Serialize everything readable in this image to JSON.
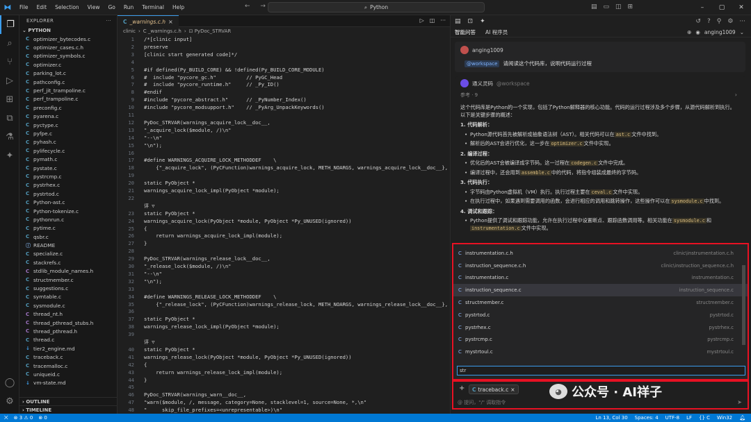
{
  "titlebar": {
    "menu": [
      "File",
      "Edit",
      "Selection",
      "View",
      "Go",
      "Run",
      "Terminal",
      "Help"
    ],
    "search": "Python",
    "nav": "← →"
  },
  "sidebar": {
    "header": "EXPLORER",
    "folder": "PYTHON",
    "files": [
      {
        "n": "optimizer_bytecodes.c",
        "t": "c"
      },
      {
        "n": "optimizer_cases.c.h",
        "t": "c"
      },
      {
        "n": "optimizer_symbols.c",
        "t": "c"
      },
      {
        "n": "optimizer.c",
        "t": "c"
      },
      {
        "n": "parking_lot.c",
        "t": "c"
      },
      {
        "n": "pathconfig.c",
        "t": "c"
      },
      {
        "n": "perf_jit_trampoline.c",
        "t": "c"
      },
      {
        "n": "perf_trampoline.c",
        "t": "c"
      },
      {
        "n": "preconfig.c",
        "t": "c"
      },
      {
        "n": "pyarena.c",
        "t": "c"
      },
      {
        "n": "pyctype.c",
        "t": "c"
      },
      {
        "n": "pyfpe.c",
        "t": "c"
      },
      {
        "n": "pyhash.c",
        "t": "c"
      },
      {
        "n": "pylifecycle.c",
        "t": "c"
      },
      {
        "n": "pymath.c",
        "t": "c"
      },
      {
        "n": "pystate.c",
        "t": "c"
      },
      {
        "n": "pystrcmp.c",
        "t": "c"
      },
      {
        "n": "pystrhex.c",
        "t": "c"
      },
      {
        "n": "pystrtod.c",
        "t": "c"
      },
      {
        "n": "Python-ast.c",
        "t": "c"
      },
      {
        "n": "Python-tokenize.c",
        "t": "c"
      },
      {
        "n": "pythonrun.c",
        "t": "c"
      },
      {
        "n": "pytime.c",
        "t": "c"
      },
      {
        "n": "qsbr.c",
        "t": "c"
      },
      {
        "n": "README",
        "t": "i"
      },
      {
        "n": "specialize.c",
        "t": "c"
      },
      {
        "n": "stackrefs.c",
        "t": "c"
      },
      {
        "n": "stdlib_module_names.h",
        "t": "h"
      },
      {
        "n": "structmember.c",
        "t": "c"
      },
      {
        "n": "suggestions.c",
        "t": "c"
      },
      {
        "n": "symtable.c",
        "t": "c"
      },
      {
        "n": "sysmodule.c",
        "t": "c"
      },
      {
        "n": "thread_nt.h",
        "t": "h"
      },
      {
        "n": "thread_pthread_stubs.h",
        "t": "h"
      },
      {
        "n": "thread_pthread.h",
        "t": "h"
      },
      {
        "n": "thread.c",
        "t": "c"
      },
      {
        "n": "tier2_engine.md",
        "t": "md"
      },
      {
        "n": "traceback.c",
        "t": "c"
      },
      {
        "n": "tracemalloc.c",
        "t": "c"
      },
      {
        "n": "uniqueid.c",
        "t": "c"
      },
      {
        "n": "vm-state.md",
        "t": "md"
      }
    ],
    "outline": "OUTLINE",
    "timeline": "TIMELINE"
  },
  "editor": {
    "tab": "_warnings.c.h",
    "tab_prefix": "C",
    "crumb": [
      "clinic",
      "C _warnings.c.h",
      "⊡ PyDoc_STRVAR"
    ],
    "lines": [
      {
        "n": "1",
        "c": "cm",
        "t": "/*[clinic input]"
      },
      {
        "n": "2",
        "c": "cm",
        "t": "preserve"
      },
      {
        "n": "3",
        "c": "cm",
        "t": "[clinic start generated code]*/"
      },
      {
        "n": "4",
        "c": "",
        "t": ""
      },
      {
        "n": "5",
        "c": "pp",
        "t": "#if defined(Py_BUILD_CORE) && !defined(Py_BUILD_CORE_MODULE)"
      },
      {
        "n": "6",
        "c": "cm",
        "t": "#  include \"pycore_gc.h\"          // PyGC_Head"
      },
      {
        "n": "7",
        "c": "cm",
        "t": "#  include \"pycore_runtime.h\"     // _Py_ID()"
      },
      {
        "n": "8",
        "c": "pp",
        "t": "#endif"
      },
      {
        "n": "9",
        "c": "pp",
        "t": "#include \"pycore_abstract.h\"      // _PyNumber_Index()"
      },
      {
        "n": "10",
        "c": "pp",
        "t": "#include \"pycore_modsupport.h\"    // _PyArg_UnpackKeywords()"
      },
      {
        "n": "11",
        "c": "",
        "t": ""
      },
      {
        "n": "12",
        "c": "",
        "t": "PyDoc_STRVAR(warnings_acquire_lock__doc__,"
      },
      {
        "n": "13",
        "c": "st",
        "t": "\"_acquire_lock($module, /)\\n\""
      },
      {
        "n": "14",
        "c": "st",
        "t": "\"--\\n\""
      },
      {
        "n": "15",
        "c": "st",
        "t": "\"\\n\");"
      },
      {
        "n": "16",
        "c": "",
        "t": ""
      },
      {
        "n": "17",
        "c": "mac",
        "t": "#define WARNINGS_ACQUIRE_LOCK_METHODDEF    \\"
      },
      {
        "n": "18",
        "c": "st",
        "t": "    {\"_acquire_lock\", (PyCFunction)warnings_acquire_lock, METH_NOARGS, warnings_acquire_lock__doc__},"
      },
      {
        "n": "19",
        "c": "",
        "t": ""
      },
      {
        "n": "20",
        "c": "kw",
        "t": "static PyObject *"
      },
      {
        "n": "21",
        "c": "",
        "t": "warnings_acquire_lock_impl(PyObject *module);"
      },
      {
        "n": "22",
        "c": "",
        "t": ""
      },
      {
        "n": "",
        "c": "codelens",
        "t": "评 ▽"
      },
      {
        "n": "23",
        "c": "kw",
        "t": "static PyObject *"
      },
      {
        "n": "24",
        "c": "",
        "t": "warnings_acquire_lock(PyObject *module, PyObject *Py_UNUSED(ignored))"
      },
      {
        "n": "25",
        "c": "",
        "t": "{"
      },
      {
        "n": "26",
        "c": "",
        "t": "    return warnings_acquire_lock_impl(module);"
      },
      {
        "n": "27",
        "c": "",
        "t": "}"
      },
      {
        "n": "28",
        "c": "",
        "t": ""
      },
      {
        "n": "29",
        "c": "",
        "t": "PyDoc_STRVAR(warnings_release_lock__doc__,"
      },
      {
        "n": "30",
        "c": "st",
        "t": "\"_release_lock($module, /)\\n\""
      },
      {
        "n": "31",
        "c": "st",
        "t": "\"--\\n\""
      },
      {
        "n": "32",
        "c": "st",
        "t": "\"\\n\");"
      },
      {
        "n": "33",
        "c": "",
        "t": ""
      },
      {
        "n": "34",
        "c": "mac",
        "t": "#define WARNINGS_RELEASE_LOCK_METHODDEF    \\"
      },
      {
        "n": "35",
        "c": "st",
        "t": "    {\"_release_lock\", (PyCFunction)warnings_release_lock, METH_NOARGS, warnings_release_lock__doc__},"
      },
      {
        "n": "36",
        "c": "",
        "t": ""
      },
      {
        "n": "37",
        "c": "kw",
        "t": "static PyObject *"
      },
      {
        "n": "38",
        "c": "",
        "t": "warnings_release_lock_impl(PyObject *module);"
      },
      {
        "n": "39",
        "c": "",
        "t": ""
      },
      {
        "n": "",
        "c": "codelens",
        "t": "评 ▽"
      },
      {
        "n": "40",
        "c": "kw",
        "t": "static PyObject *"
      },
      {
        "n": "41",
        "c": "",
        "t": "warnings_release_lock(PyObject *module, PyObject *Py_UNUSED(ignored))"
      },
      {
        "n": "42",
        "c": "",
        "t": "{"
      },
      {
        "n": "43",
        "c": "",
        "t": "    return warnings_release_lock_impl(module);"
      },
      {
        "n": "44",
        "c": "",
        "t": "}"
      },
      {
        "n": "45",
        "c": "",
        "t": ""
      },
      {
        "n": "46",
        "c": "",
        "t": "PyDoc_STRVAR(warnings_warn__doc__,"
      },
      {
        "n": "47",
        "c": "st",
        "t": "\"warn($module, /, message, category=None, stacklevel=1, source=None, *,\\n\""
      },
      {
        "n": "48",
        "c": "st",
        "t": "\"     skip_file_prefixes=<unrepresentable>)\\n\""
      },
      {
        "n": "49",
        "c": "st",
        "t": "\"--\\n\""
      }
    ]
  },
  "panel": {
    "tabs": [
      "智能问答",
      "AI 程序员"
    ],
    "user": "anging1009",
    "question": {
      "user": "anging1009",
      "tag": "@workspace",
      "text": "请阅读这个代码库，说明代码运行过程"
    },
    "answer": {
      "bot": "通义灵码",
      "tag": "@workspace",
      "ref": "参考 · 9",
      "intro": "这个代码库是Python的一个实现，包括了Python解释器的核心功能。代码的运行过程涉及多个步骤，从源代码解析到执行。以下是关键步骤的概述：",
      "s1": "1. 代码解析：",
      "s1a": "Python源代码首先被解析成抽象语法树（AST）。相关代码可以在",
      "s1a_c": "ast.c",
      "s1a_e": "文件中找到。",
      "s1b": "解析后的AST会进行优化，这一步在",
      "s1b_c": "optimizer.c",
      "s1b_e": "文件中实现。",
      "s2": "2. 编译过程：",
      "s2a": "优化后的AST会被编译成字节码。这一过程在",
      "s2a_c": "codegen.c",
      "s2a_e": "文件中完成。",
      "s2b": "编译过程中，还会用到",
      "s2b_c": "assemble.c",
      "s2b_e": "中的代码，将指令组装成最终的字节码。",
      "s3": "3. 代码执行：",
      "s3a": "字节码由Python虚拟机（VM）执行。执行过程主要在",
      "s3a_c": "ceval.c",
      "s3a_e": "文件中实现。",
      "s3b": "在执行过程中，如果遇到需要调用的函数，会进行相应的调用和跳转操作，这些操作可以在",
      "s3b_c": "sysmodule.c",
      "s3b_e": "中找到。",
      "s4": "4. 调试和跟踪：",
      "s4a": "Python提供了调试和跟踪功能，允许在执行过程中设置断点、跟踪函数调用等。相关功能在",
      "s4a_c": "sysmodule.c",
      "s4a_e": "和",
      "s4b_c": "instrumentation.c",
      "s4b_e": "文件中实现。"
    }
  },
  "popup": {
    "items": [
      {
        "n": "instrumentation.c.h",
        "p": "clinic\\instrumentation.c.h"
      },
      {
        "n": "instruction_sequence.c.h",
        "p": "clinic\\instruction_sequence.c.h"
      },
      {
        "n": "instrumentation.c",
        "p": "instrumentation.c"
      },
      {
        "n": "instruction_sequence.c",
        "p": "instruction_sequence.c"
      },
      {
        "n": "structmember.c",
        "p": "structmember.c"
      },
      {
        "n": "pystrtod.c",
        "p": "pystrtod.c"
      },
      {
        "n": "pystrhex.c",
        "p": "pystrhex.c"
      },
      {
        "n": "pystrcmp.c",
        "p": "pystrcmp.c"
      },
      {
        "n": "mystrtoul.c",
        "p": "mystrtoul.c"
      }
    ],
    "query": "str"
  },
  "ctx": {
    "chip": "traceback.c",
    "placeholder": "@ 提问，\"/\" 调取指令"
  },
  "watermark": "公众号 · AI祥子",
  "status": {
    "left": [
      "⊗ 3 ⚠ 0",
      "⊗ 0"
    ],
    "right": [
      "Ln 13, Col 30",
      "Spaces: 4",
      "UTF-8",
      "LF",
      "{} C",
      "Win32"
    ]
  }
}
